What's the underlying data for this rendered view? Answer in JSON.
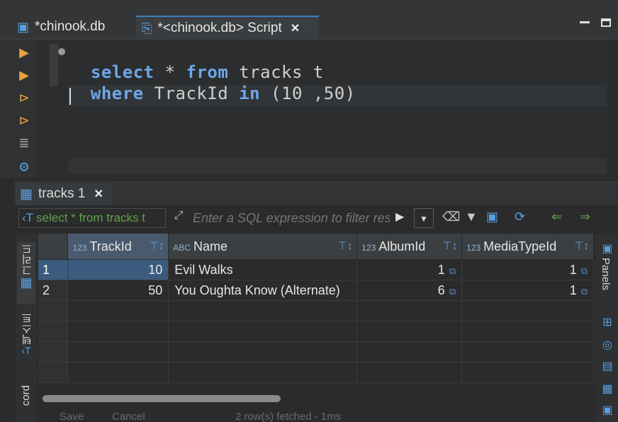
{
  "editor_tabs": [
    {
      "label": "*chinook.db"
    },
    {
      "label": "*<chinook.db> Script",
      "close": "✕"
    }
  ],
  "sql": {
    "line1": {
      "kw1": "select",
      "rest1": " * ",
      "kw2": "from",
      "rest2": " tracks t"
    },
    "line2": {
      "kw1": "where",
      "rest1": " TrackId ",
      "kw2": "in",
      "rest2": " (10 ,50)"
    }
  },
  "results": {
    "tab_label": "tracks 1",
    "close": "✕",
    "filter_sql_text": "select * from tracks t",
    "filter_placeholder": "Enter a SQL expression to filter results"
  },
  "grid": {
    "columns": [
      {
        "type": "123",
        "name": "TrackId"
      },
      {
        "type": "ABC",
        "name": "Name"
      },
      {
        "type": "123",
        "name": "AlbumId"
      },
      {
        "type": "123",
        "name": "MediaTypeId"
      }
    ],
    "rows": [
      {
        "num": "1",
        "TrackId": "10",
        "Name": "Evil Walks",
        "AlbumId": "1",
        "MediaTypeId": "1"
      },
      {
        "num": "2",
        "TrackId": "50",
        "Name": "You Oughta Know (Alternate)",
        "AlbumId": "6",
        "MediaTypeId": "1"
      }
    ]
  },
  "left_vtabs": {
    "grid_label": "그리드",
    "text_label": "텍스트",
    "record_label": "cord"
  },
  "right_panel": {
    "label": "Panels"
  },
  "status": {
    "save": "Save",
    "cancel": "Cancel",
    "fetched": "2 row(s) fetched - 1ms"
  },
  "colors": {
    "keyword": "#6ea6e8",
    "selection": "#3a5b7d",
    "accent": "#3f7ec4",
    "sql_green": "#5fa24a"
  }
}
